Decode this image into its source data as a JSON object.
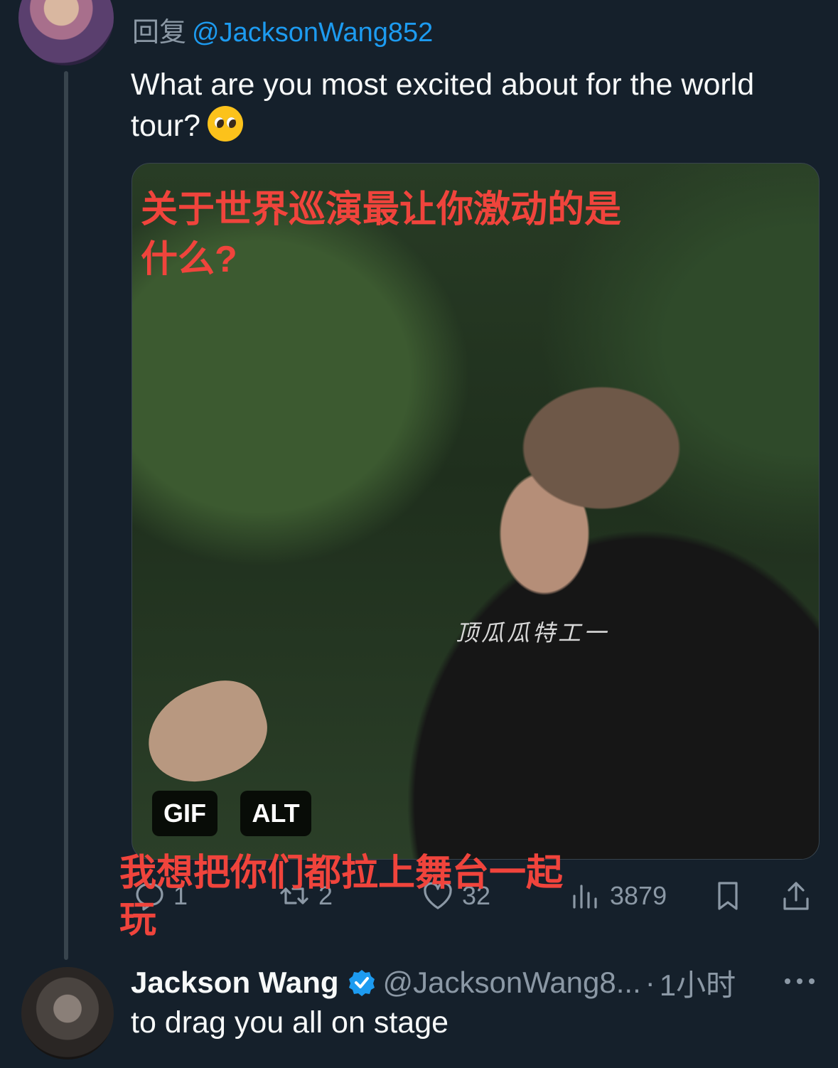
{
  "parent_tweet": {
    "reply_prefix": "回复",
    "reply_to": "@JacksonWang852",
    "text": "What are you most excited about for the world tour?",
    "emoji": "pleading-face-emoji",
    "media": {
      "caption_top": "关于世界巡演最让你激动的是什么?",
      "caption_subtitle": "顶瓜瓜特工一",
      "caption_bottom": "我想把你们都拉上舞台一起玩",
      "badges": {
        "gif": "GIF",
        "alt": "ALT"
      }
    },
    "actions": {
      "replies": "1",
      "retweets": "2",
      "likes": "32",
      "views": "3879"
    }
  },
  "reply_tweet": {
    "display_name": "Jackson Wang",
    "verified": true,
    "handle": "@JacksonWang8...",
    "separator": "·",
    "time": "1小时",
    "text": "to drag you all on stage"
  },
  "colors": {
    "background": "#15202b",
    "accent": "#1d9bf0",
    "muted": "#8b98a5",
    "caption_red": "#f0443c"
  }
}
